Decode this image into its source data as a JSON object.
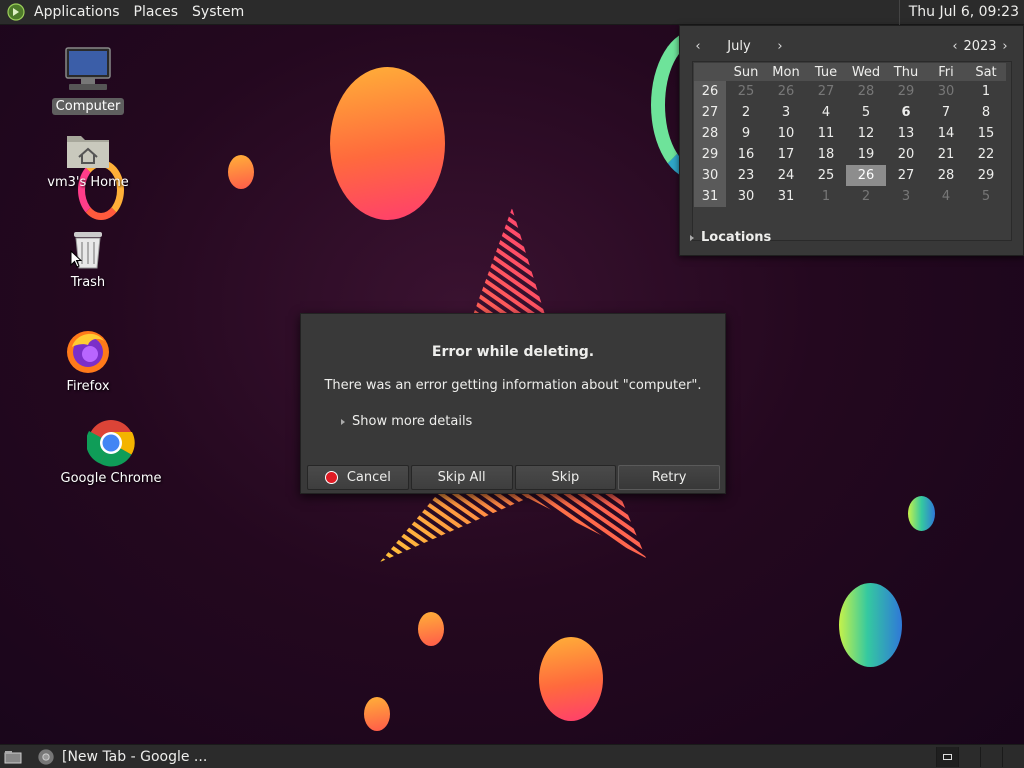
{
  "top_panel": {
    "menus": [
      "Applications",
      "Places",
      "System"
    ],
    "clock": "Thu Jul  6, 09:23"
  },
  "desktop_icons": [
    {
      "label": "Computer",
      "icon": "computer-icon",
      "selected": true
    },
    {
      "label": "vm3's Home",
      "icon": "home-folder-icon"
    },
    {
      "label": "Trash",
      "icon": "trash-icon"
    },
    {
      "label": "Firefox",
      "icon": "firefox-icon"
    },
    {
      "label": "Google Chrome",
      "icon": "chrome-icon"
    }
  ],
  "calendar": {
    "month": "July",
    "year": "2023",
    "weekdays": [
      "Sun",
      "Mon",
      "Tue",
      "Wed",
      "Thu",
      "Fri",
      "Sat"
    ],
    "weeks": [
      {
        "wk": "26",
        "days": [
          {
            "d": "25",
            "dim": true
          },
          {
            "d": "26",
            "dim": true
          },
          {
            "d": "27",
            "dim": true
          },
          {
            "d": "28",
            "dim": true
          },
          {
            "d": "29",
            "dim": true
          },
          {
            "d": "30",
            "dim": true
          },
          {
            "d": "1"
          }
        ]
      },
      {
        "wk": "27",
        "days": [
          {
            "d": "2"
          },
          {
            "d": "3"
          },
          {
            "d": "4"
          },
          {
            "d": "5"
          },
          {
            "d": "6",
            "today": true
          },
          {
            "d": "7"
          },
          {
            "d": "8"
          }
        ]
      },
      {
        "wk": "28",
        "days": [
          {
            "d": "9"
          },
          {
            "d": "10"
          },
          {
            "d": "11"
          },
          {
            "d": "12"
          },
          {
            "d": "13"
          },
          {
            "d": "14"
          },
          {
            "d": "15"
          }
        ]
      },
      {
        "wk": "29",
        "days": [
          {
            "d": "16"
          },
          {
            "d": "17"
          },
          {
            "d": "18"
          },
          {
            "d": "19"
          },
          {
            "d": "20"
          },
          {
            "d": "21"
          },
          {
            "d": "22"
          }
        ]
      },
      {
        "wk": "30",
        "days": [
          {
            "d": "23"
          },
          {
            "d": "24"
          },
          {
            "d": "25"
          },
          {
            "d": "26",
            "selected": true
          },
          {
            "d": "27"
          },
          {
            "d": "28"
          },
          {
            "d": "29"
          }
        ]
      },
      {
        "wk": "31",
        "days": [
          {
            "d": "30"
          },
          {
            "d": "31"
          },
          {
            "d": "1",
            "dim": true
          },
          {
            "d": "2",
            "dim": true
          },
          {
            "d": "3",
            "dim": true
          },
          {
            "d": "4",
            "dim": true
          },
          {
            "d": "5",
            "dim": true
          }
        ]
      }
    ],
    "locations_label": "Locations"
  },
  "dialog": {
    "title": "Error while deleting.",
    "message": "There was an error getting information about \"computer\".",
    "details_label": "Show more details",
    "buttons": {
      "cancel": "Cancel",
      "skip_all": "Skip All",
      "skip": "Skip",
      "retry": "Retry"
    }
  },
  "bottom_panel": {
    "task_label": "[New Tab - Google ..."
  }
}
